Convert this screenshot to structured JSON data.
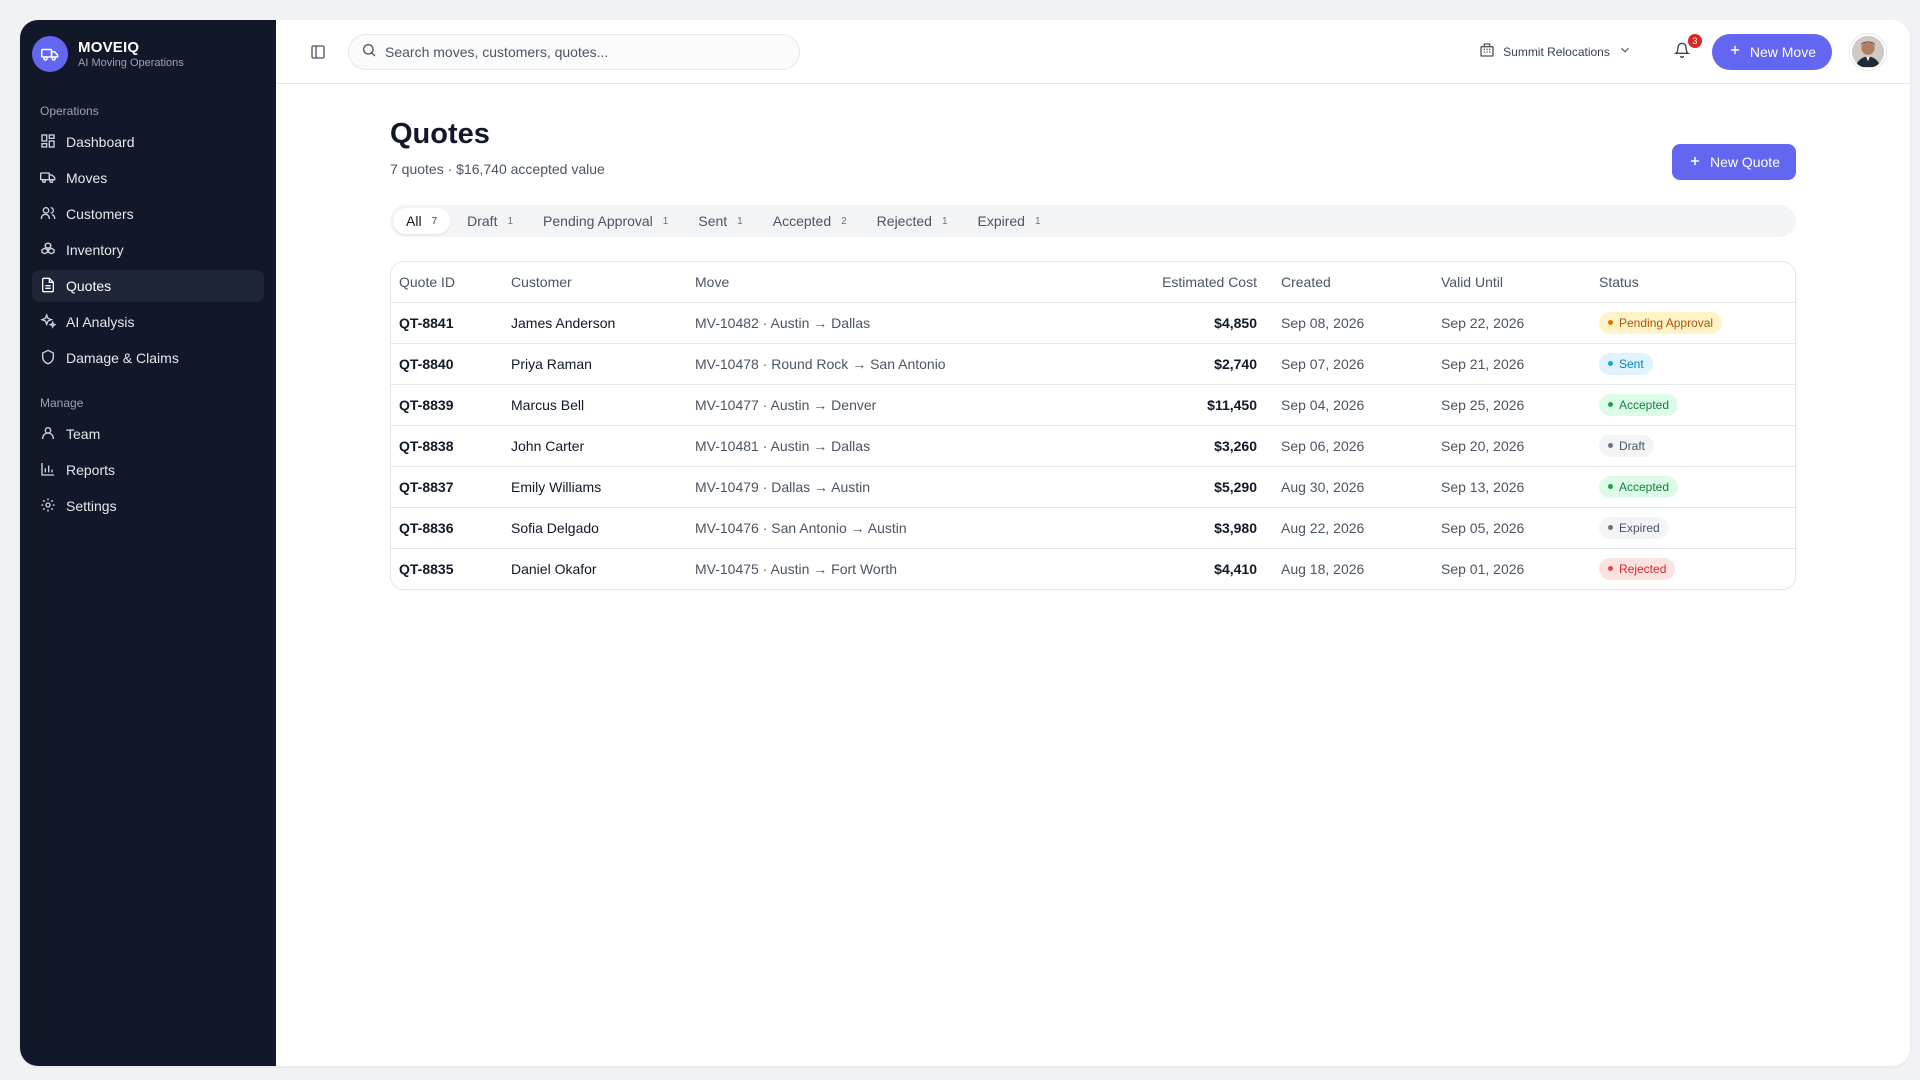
{
  "brand": {
    "name": "MOVEIQ",
    "subtitle": "AI Moving Operations"
  },
  "sidebar": {
    "operations_label": "Operations",
    "operations": [
      {
        "label": "Dashboard",
        "icon": "dashboard-icon"
      },
      {
        "label": "Moves",
        "icon": "truck-icon"
      },
      {
        "label": "Customers",
        "icon": "users-icon"
      },
      {
        "label": "Inventory",
        "icon": "boxes-icon"
      },
      {
        "label": "Quotes",
        "icon": "document-icon",
        "active": true
      },
      {
        "label": "AI Analysis",
        "icon": "sparkles-icon"
      },
      {
        "label": "Damage & Claims",
        "icon": "shield-icon"
      }
    ],
    "manage_label": "Manage",
    "manage": [
      {
        "label": "Team",
        "icon": "user-icon"
      },
      {
        "label": "Reports",
        "icon": "bar-chart-icon"
      },
      {
        "label": "Settings",
        "icon": "gear-icon"
      }
    ]
  },
  "topbar": {
    "search_placeholder": "Search moves, customers, quotes...",
    "org_name": "Summit Relocations",
    "notification_count": "3",
    "new_move_label": "New Move"
  },
  "page": {
    "title": "Quotes",
    "subtitle": "7 quotes · $16,740 accepted value",
    "new_quote_label": "New Quote"
  },
  "tabs": [
    {
      "label": "All",
      "count": "7",
      "active": true
    },
    {
      "label": "Draft",
      "count": "1"
    },
    {
      "label": "Pending Approval",
      "count": "1"
    },
    {
      "label": "Sent",
      "count": "1"
    },
    {
      "label": "Accepted",
      "count": "2"
    },
    {
      "label": "Rejected",
      "count": "1"
    },
    {
      "label": "Expired",
      "count": "1"
    }
  ],
  "table": {
    "headers": {
      "quote_id": "Quote ID",
      "customer": "Customer",
      "move": "Move",
      "estimated_cost": "Estimated Cost",
      "created": "Created",
      "valid_until": "Valid Until",
      "status": "Status"
    },
    "rows": [
      {
        "id": "QT-8841",
        "customer": "James Anderson",
        "move": "MV-10482 · Austin → Dallas",
        "cost": "$4,850",
        "created": "Sep 08, 2026",
        "valid": "Sep 22, 2026",
        "status": "Pending Approval",
        "status_key": "pending"
      },
      {
        "id": "QT-8840",
        "customer": "Priya Raman",
        "move": "MV-10478 · Round Rock → San Antonio",
        "cost": "$2,740",
        "created": "Sep 07, 2026",
        "valid": "Sep 21, 2026",
        "status": "Sent",
        "status_key": "sent"
      },
      {
        "id": "QT-8839",
        "customer": "Marcus Bell",
        "move": "MV-10477 · Austin → Denver",
        "cost": "$11,450",
        "created": "Sep 04, 2026",
        "valid": "Sep 25, 2026",
        "status": "Accepted",
        "status_key": "accepted"
      },
      {
        "id": "QT-8838",
        "customer": "John Carter",
        "move": "MV-10481 · Austin → Dallas",
        "cost": "$3,260",
        "created": "Sep 06, 2026",
        "valid": "Sep 20, 2026",
        "status": "Draft",
        "status_key": "draft"
      },
      {
        "id": "QT-8837",
        "customer": "Emily Williams",
        "move": "MV-10479 · Dallas → Austin",
        "cost": "$5,290",
        "created": "Aug 30, 2026",
        "valid": "Sep 13, 2026",
        "status": "Accepted",
        "status_key": "accepted"
      },
      {
        "id": "QT-8836",
        "customer": "Sofia Delgado",
        "move": "MV-10476 · San Antonio → Austin",
        "cost": "$3,980",
        "created": "Aug 22, 2026",
        "valid": "Sep 05, 2026",
        "status": "Expired",
        "status_key": "expired"
      },
      {
        "id": "QT-8835",
        "customer": "Daniel Okafor",
        "move": "MV-10475 · Austin → Fort Worth",
        "cost": "$4,410",
        "created": "Aug 18, 2026",
        "valid": "Sep 01, 2026",
        "status": "Rejected",
        "status_key": "rejected"
      }
    ]
  },
  "colors": {
    "accent": "#6366f1",
    "sidebar_bg": "#121829",
    "badge_notification": "#dc2626"
  }
}
